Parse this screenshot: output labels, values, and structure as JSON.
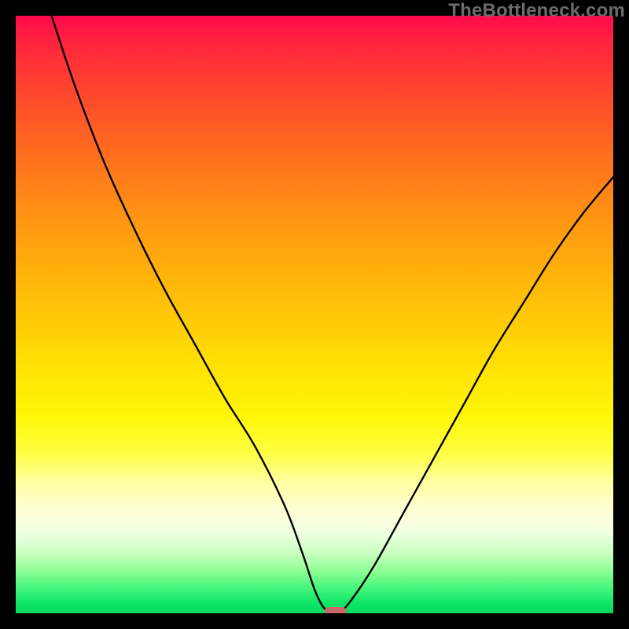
{
  "watermark": "TheBottleneck.com",
  "chart_data": {
    "type": "line",
    "title": "",
    "xlabel": "",
    "ylabel": "",
    "xlim": [
      0,
      100
    ],
    "ylim": [
      0,
      100
    ],
    "grid": false,
    "legend": false,
    "background_gradient": {
      "top": "#ff0a4c",
      "bottom": "#00d85c",
      "stops": [
        "red",
        "orange",
        "yellow",
        "pale-yellow",
        "green"
      ]
    },
    "series": [
      {
        "name": "bottleneck-curve",
        "x": [
          6,
          10,
          15,
          20,
          25,
          30,
          35,
          40,
          45,
          48,
          50,
          51.5,
          53,
          54,
          56,
          60,
          65,
          70,
          75,
          80,
          85,
          90,
          95,
          100
        ],
        "y": [
          100,
          88,
          75,
          64,
          54,
          45,
          36,
          28,
          18,
          10,
          4,
          1,
          0,
          0,
          2,
          8,
          17,
          26,
          35,
          44,
          52,
          60,
          67,
          73
        ]
      }
    ],
    "marker": {
      "name": "optimal-point",
      "x": 53.5,
      "y": 0,
      "color": "#c96a66",
      "shape": "rounded-rect"
    }
  }
}
